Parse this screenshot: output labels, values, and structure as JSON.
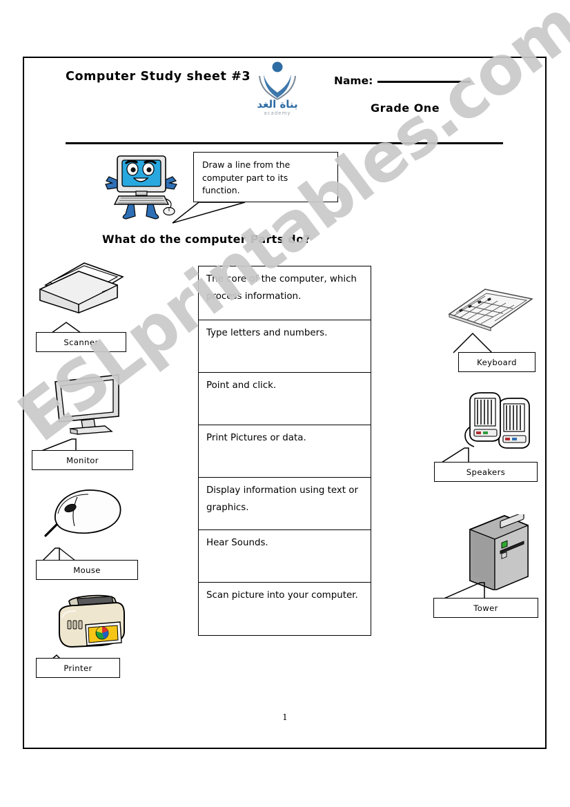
{
  "header": {
    "title": "Computer  Study sheet #3",
    "name_label": "Name:",
    "grade": "Grade One",
    "logo_alt": "academy-logo",
    "logo_arabic": "بناة الغد",
    "logo_subtext": "academy",
    "logo_color": "#2e6ca4",
    "logo_gray": "#9aa0a6"
  },
  "instruction": {
    "line1": "Draw a line from the",
    "line2": "computer part to its",
    "line3": "function."
  },
  "question": "What do the computer Parts do?",
  "functions": [
    "The core of the computer, which process information.",
    "Type letters and numbers.",
    "Point and click.",
    "Print Pictures or data.",
    "Display information using text or graphics.",
    "Hear Sounds.",
    "Scan picture into your computer."
  ],
  "left_devices": [
    {
      "label": "Scanner",
      "icon": "scanner-icon"
    },
    {
      "label": "Monitor",
      "icon": "monitor-icon"
    },
    {
      "label": "Mouse",
      "icon": "mouse-icon"
    },
    {
      "label": "Printer",
      "icon": "printer-icon"
    }
  ],
  "right_devices": [
    {
      "label": "Keyboard",
      "icon": "keyboard-icon"
    },
    {
      "label": "Speakers",
      "icon": "speakers-icon"
    },
    {
      "label": "Tower",
      "icon": "tower-icon"
    }
  ],
  "watermark": "ESLprintables.com",
  "page_number": "1",
  "colors": {
    "ink": "#000000",
    "watermark": "#c9c9c9",
    "mascot_blue": "#29a8e0",
    "mascot_body_blue": "#2f6fb5",
    "printer_cream": "#efe6cf",
    "tower_gray": "#a8a8a8",
    "led_green": "#2fa82f"
  }
}
